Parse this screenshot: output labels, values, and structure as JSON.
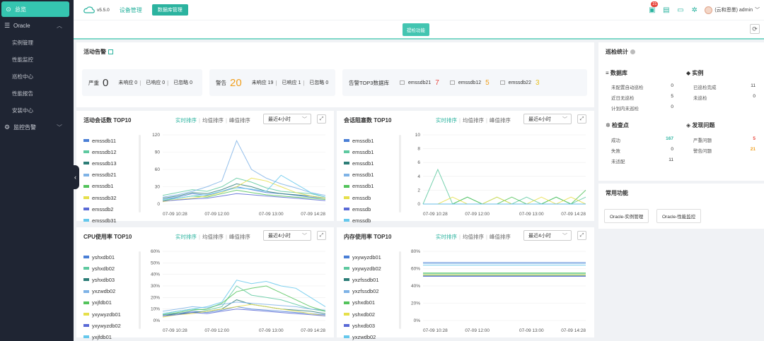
{
  "sidebar": {
    "items": [
      {
        "label": "总览",
        "icon": "dashboard-icon",
        "active": true
      },
      {
        "label": "Oracle",
        "icon": "database-icon",
        "expanded": true,
        "children": [
          "实例管理",
          "性能监控",
          "巡检中心",
          "性能报告",
          "安装中心"
        ]
      },
      {
        "label": "监控告警",
        "icon": "bell-icon",
        "expanded": false
      }
    ]
  },
  "topbar": {
    "version": "v5.5.0",
    "nav": [
      "设备管理",
      "数据库管理"
    ],
    "badge_count": "21",
    "user": "(云和恩墨) admin"
  },
  "subbar": {
    "inspect_button": "提检功能"
  },
  "alerts": {
    "title": "活动告警",
    "cards": [
      {
        "label": "严重",
        "count": "0",
        "unhandled": "未响应 0",
        "handled": "已响应 0",
        "ignored": "已忽略 0"
      },
      {
        "label": "警告",
        "count": "20",
        "unhandled": "未响应 19",
        "handled": "已响应 1",
        "ignored": "已忽略 0"
      }
    ],
    "top3_label": "告警TOP3数据库",
    "top3": [
      {
        "name": "emssdb21",
        "count": "7",
        "color": "#e8463d"
      },
      {
        "name": "emssdb12",
        "count": "5",
        "color": "#f0a020"
      },
      {
        "name": "emssdb22",
        "count": "3",
        "color": "#f0c020"
      }
    ]
  },
  "stats": {
    "title": "巡检统计",
    "db_section": "数据库",
    "db_rows": [
      {
        "k": "未配置自动巡检",
        "v": "0"
      },
      {
        "k": "近日无巡检",
        "v": "5"
      },
      {
        "k": "计划内未巡检",
        "v": "0"
      }
    ],
    "inst_section": "实例",
    "inst_rows": [
      {
        "k": "已巡检完成",
        "v": "11"
      },
      {
        "k": "未巡检",
        "v": "0"
      }
    ],
    "check_section": "检查点",
    "check_rows": [
      {
        "k": "成功",
        "v": "167"
      },
      {
        "k": "失败",
        "v": "0"
      },
      {
        "k": "未适配",
        "v": "11"
      }
    ],
    "issue_section": "发现问题",
    "issue_rows": [
      {
        "k": "严重问题",
        "v": "5"
      },
      {
        "k": "警告问题",
        "v": "21"
      }
    ]
  },
  "common": {
    "title": "常用功能",
    "buttons": [
      "Oracle-实例管理",
      "Oracle-性能监控"
    ]
  },
  "chart_tabs": [
    "实时排序",
    "均值排序",
    "峰值排序"
  ],
  "chart_range": "最近4小时",
  "chart_data": [
    {
      "type": "line",
      "title": "活动会话数 TOP10",
      "x": [
        "07-09 10:28",
        "07-09 12:00",
        "07-09 13:00",
        "07-09 14:28"
      ],
      "ylim": [
        0,
        120
      ],
      "yticks": [
        0,
        30,
        60,
        90,
        120
      ],
      "yunit": "",
      "series": [
        {
          "name": "emssdb11",
          "color": "#4a7fd6",
          "values": [
            8,
            12,
            18,
            15,
            22,
            30,
            25,
            20,
            18,
            15,
            12,
            10
          ]
        },
        {
          "name": "emssdb12",
          "color": "#5ec9a0",
          "values": [
            15,
            20,
            25,
            22,
            30,
            45,
            38,
            28,
            22,
            20,
            18,
            12
          ]
        },
        {
          "name": "emssdb13",
          "color": "#2c7d77",
          "values": [
            10,
            14,
            20,
            18,
            25,
            35,
            30,
            22,
            18,
            16,
            14,
            10
          ]
        },
        {
          "name": "emssdb21",
          "color": "#7fb3e6",
          "values": [
            12,
            16,
            22,
            30,
            40,
            110,
            60,
            45,
            35,
            28,
            20,
            15
          ]
        },
        {
          "name": "emssdb1",
          "color": "#53c35b",
          "values": [
            6,
            10,
            14,
            12,
            18,
            24,
            20,
            16,
            14,
            12,
            10,
            8
          ]
        },
        {
          "name": "emssdb32",
          "color": "#e6df4a",
          "values": [
            4,
            8,
            10,
            14,
            20,
            30,
            45,
            40,
            30,
            20,
            14,
            10
          ]
        },
        {
          "name": "emssdb2",
          "color": "#5a6ad6",
          "values": [
            5,
            7,
            9,
            10,
            14,
            18,
            16,
            14,
            12,
            10,
            8,
            6
          ]
        },
        {
          "name": "emssdb31",
          "color": "#66c8ec",
          "values": [
            8,
            10,
            14,
            16,
            22,
            28,
            26,
            22,
            50,
            35,
            20,
            12
          ]
        }
      ]
    },
    {
      "type": "line",
      "title": "会话阻塞数 TOP10",
      "x": [
        "07-09 10:28",
        "07-09 12:00",
        "07-09 13:00",
        "07-09 14:28"
      ],
      "ylim": [
        0,
        10
      ],
      "yticks": [
        0,
        2,
        4,
        6,
        8,
        10
      ],
      "yunit": "",
      "series": [
        {
          "name": "emssdb1",
          "color": "#4a7fd6",
          "values": [
            0,
            0,
            0,
            0,
            0,
            0,
            0,
            0,
            0,
            0,
            0,
            0
          ]
        },
        {
          "name": "emssdb1",
          "color": "#5ec9a0",
          "values": [
            0,
            5,
            0,
            1,
            0,
            1,
            0,
            1,
            0,
            1,
            0,
            1
          ]
        },
        {
          "name": "emssdb1",
          "color": "#2c7d77",
          "values": [
            0,
            0,
            0,
            0,
            0,
            0,
            0,
            0,
            0,
            0,
            0,
            0
          ]
        },
        {
          "name": "emssdb1",
          "color": "#7fb3e6",
          "values": [
            0,
            0,
            0,
            0,
            0,
            0,
            0,
            0,
            0,
            0,
            0,
            0
          ]
        },
        {
          "name": "emssdb1",
          "color": "#53c35b",
          "values": [
            0,
            0,
            0,
            1,
            0,
            0,
            1,
            0,
            0,
            1,
            0,
            2
          ]
        },
        {
          "name": "emssdb",
          "color": "#e6df4a",
          "values": [
            0,
            0,
            1,
            0,
            0,
            1,
            0,
            0,
            1,
            0,
            1,
            0
          ]
        },
        {
          "name": "emssdb",
          "color": "#5a6ad6",
          "values": [
            0,
            0,
            0,
            0,
            0,
            0,
            0,
            0,
            0,
            0,
            0,
            0
          ]
        },
        {
          "name": "emssdb",
          "color": "#66c8ec",
          "values": [
            0,
            0,
            0,
            0,
            0,
            0,
            0,
            0,
            0,
            0,
            0,
            0
          ]
        }
      ]
    },
    {
      "type": "line",
      "title": "CPU使用率 TOP10",
      "x": [
        "07-09 10:28",
        "07-09 12:00",
        "07-09 13:00",
        "07-09 14:28"
      ],
      "ylim": [
        0,
        60
      ],
      "yticks": [
        0,
        10,
        20,
        30,
        40,
        50,
        60
      ],
      "yunit": "%",
      "series": [
        {
          "name": "yshxdb01",
          "color": "#4a7fd6",
          "values": [
            5,
            6,
            8,
            7,
            9,
            12,
            10,
            9,
            8,
            7,
            6,
            5
          ]
        },
        {
          "name": "yshxdb02",
          "color": "#5ec9a0",
          "values": [
            6,
            8,
            10,
            9,
            12,
            30,
            22,
            20,
            18,
            14,
            10,
            8
          ]
        },
        {
          "name": "yshxdb03",
          "color": "#2c7d77",
          "values": [
            4,
            6,
            7,
            8,
            10,
            18,
            14,
            12,
            10,
            9,
            8,
            6
          ]
        },
        {
          "name": "yxzwdb02",
          "color": "#7fb3e6",
          "values": [
            8,
            10,
            12,
            11,
            14,
            16,
            15,
            14,
            13,
            12,
            10,
            9
          ]
        },
        {
          "name": "yxjfdb01",
          "color": "#53c35b",
          "values": [
            5,
            7,
            9,
            10,
            15,
            25,
            28,
            30,
            24,
            18,
            12,
            8
          ]
        },
        {
          "name": "yxywyzdb01",
          "color": "#e6df4a",
          "values": [
            3,
            5,
            6,
            8,
            10,
            12,
            14,
            12,
            10,
            8,
            6,
            4
          ]
        },
        {
          "name": "yxywyzdb02",
          "color": "#5a6ad6",
          "values": [
            4,
            5,
            7,
            6,
            8,
            10,
            9,
            8,
            7,
            6,
            5,
            4
          ]
        },
        {
          "name": "yxjfdb01",
          "color": "#66c8ec",
          "values": [
            6,
            8,
            10,
            12,
            16,
            35,
            32,
            34,
            30,
            28,
            20,
            12
          ]
        }
      ]
    },
    {
      "type": "line",
      "title": "内存使用率 TOP10",
      "x": [
        "07-09 10:28",
        "07-09 12:00",
        "07-09 13:00",
        "07-09 14:28"
      ],
      "ylim": [
        0,
        80
      ],
      "yticks": [
        0,
        20,
        40,
        60,
        80
      ],
      "yunit": "%",
      "series": [
        {
          "name": "yxywyzdb01",
          "color": "#4a7fd6",
          "values": [
            67,
            67,
            67,
            67,
            67,
            67,
            67,
            67,
            67,
            67,
            67,
            67
          ]
        },
        {
          "name": "yxywyzdb02",
          "color": "#5ec9a0",
          "values": [
            54,
            54,
            54,
            54,
            54,
            54,
            54,
            54,
            54,
            54,
            54,
            54
          ]
        },
        {
          "name": "yxzfssdb01",
          "color": "#2c7d77",
          "values": [
            52,
            52,
            52,
            52,
            52,
            52,
            52,
            52,
            52,
            52,
            52,
            52
          ]
        },
        {
          "name": "yxzfssdb02",
          "color": "#7fb3e6",
          "values": [
            66,
            66,
            66,
            66,
            66,
            66,
            66,
            66,
            66,
            66,
            66,
            66
          ]
        },
        {
          "name": "yshxdb01",
          "color": "#53c35b",
          "values": [
            55,
            55,
            55,
            55,
            55,
            55,
            55,
            55,
            55,
            55,
            55,
            55
          ]
        },
        {
          "name": "yshxdb02",
          "color": "#e6df4a",
          "values": [
            53,
            53,
            53,
            53,
            53,
            53,
            53,
            53,
            53,
            53,
            53,
            53
          ]
        },
        {
          "name": "yshxdb03",
          "color": "#5a6ad6",
          "values": [
            51,
            51,
            51,
            51,
            51,
            51,
            51,
            51,
            51,
            51,
            51,
            51
          ]
        },
        {
          "name": "yxzwdb02",
          "color": "#66c8ec",
          "values": [
            64,
            64,
            64,
            64,
            64,
            64,
            64,
            64,
            64,
            64,
            64,
            64
          ]
        }
      ]
    }
  ]
}
